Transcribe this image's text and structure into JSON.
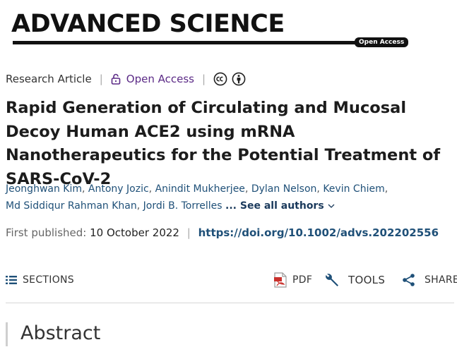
{
  "masthead": {
    "journal_name": "ADVANCED SCIENCE",
    "badge": "Open Access"
  },
  "meta": {
    "article_type": "Research Article",
    "open_access": "Open Access",
    "license_icons": [
      "cc-icon",
      "by-icon"
    ]
  },
  "title": "Rapid Generation of Circulating and Mucosal Decoy Human ACE2 using mRNA Nanotherapeutics for the Potential Treatment of SARS-CoV-2",
  "authors": {
    "names": [
      "Jeonghwan Kim",
      "Antony Jozic",
      "Anindit Mukherjee",
      "Dylan Nelson",
      "Kevin Chiem",
      "Md Siddiqur Rahman Khan",
      "Jordi B. Torrelles"
    ],
    "see_all": "... See all authors"
  },
  "publication": {
    "label": "First published:",
    "date": "10 October 2022",
    "separator": "|",
    "doi": "https://doi.org/10.1002/advs.202202556"
  },
  "toolbar": {
    "sections": "SECTIONS",
    "pdf": "PDF",
    "tools": "TOOLS",
    "share": "SHARE"
  },
  "abstract": {
    "heading": "Abstract"
  },
  "colors": {
    "accent_purple": "#5b2a86",
    "link_blue": "#1f5078",
    "pdf_red": "#c9302c"
  }
}
